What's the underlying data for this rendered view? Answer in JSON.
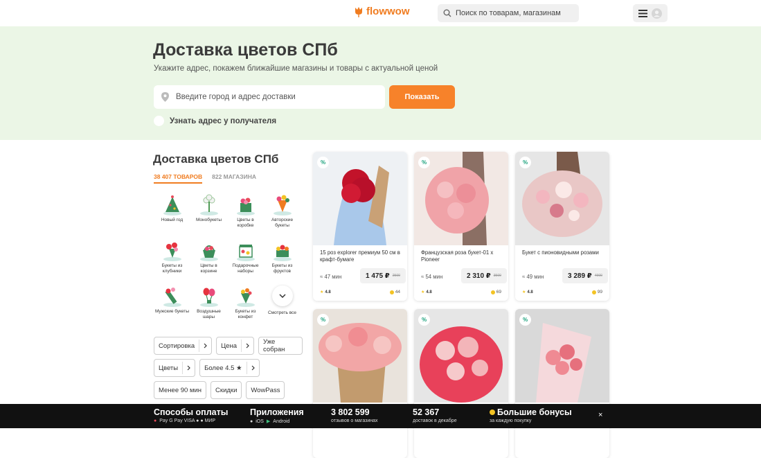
{
  "header": {
    "logo_text": "flowwow",
    "search_placeholder": "Поиск по товарам, магазинам"
  },
  "hero": {
    "title": "Доставка цветов СПб",
    "subtitle": "Укажите адрес, покажем ближайшие магазины и товары с актуальной ценой",
    "address_placeholder": "Введите город и адрес доставки",
    "show_button": "Показать",
    "recipient_label": "Узнать адрес у получателя"
  },
  "sidebar": {
    "title": "Доставка цветов СПб",
    "tabs": [
      "38 407 ТОВАРОВ",
      "822 МАГАЗИНА"
    ],
    "categories": [
      {
        "label": "Новый год",
        "icon": "christmas-tree-icon"
      },
      {
        "label": "Монобукеты",
        "icon": "mono-bouquet-icon"
      },
      {
        "label": "Цветы в коробке",
        "icon": "flower-box-icon"
      },
      {
        "label": "Авторские букеты",
        "icon": "author-bouquet-icon"
      },
      {
        "label": "Букеты из клубники",
        "icon": "strawberry-bouquet-icon"
      },
      {
        "label": "Цветы в корзине",
        "icon": "flower-basket-icon"
      },
      {
        "label": "Подарочные наборы",
        "icon": "gift-set-icon"
      },
      {
        "label": "Букеты из фруктов",
        "icon": "fruit-bouquet-icon"
      },
      {
        "label": "Мужские букеты",
        "icon": "mens-bouquet-icon"
      },
      {
        "label": "Воздушные шары",
        "icon": "balloons-icon"
      },
      {
        "label": "Букеты из конфет",
        "icon": "candy-bouquet-icon"
      }
    ],
    "see_all": "Смотреть все",
    "filters": {
      "sort": "Сортировка",
      "price": "Цена",
      "assembled": "Уже собран",
      "flowers": "Цветы",
      "rating": "Более 4.5 ★",
      "time": "Менее 90 мин",
      "discounts": "Скидки",
      "wowpass": "WowPass"
    }
  },
  "products": [
    {
      "name": "15 роз explorer премиум 50 см в крафт-бумаге",
      "time": "≈ 47 мин",
      "price": "1 475 ₽",
      "old_price": "2500",
      "rating": "4.8",
      "bonus": "44",
      "badge": "%",
      "colors": [
        "#aac8e6",
        "#c2132a"
      ]
    },
    {
      "name": "Французская роза букет-01 х Pioneer",
      "time": "≈ 54 мин",
      "price": "2 310 ₽",
      "old_price": "3500",
      "rating": "4.8",
      "bonus": "69",
      "badge": "%",
      "colors": [
        "#f2e8e4",
        "#f0a3a8"
      ]
    },
    {
      "name": "Букет с пионовидными розами",
      "time": "≈ 49 мин",
      "price": "3 289 ₽",
      "old_price": "4900",
      "rating": "4.8",
      "bonus": "99",
      "badge": "%",
      "colors": [
        "#e6e6e6",
        "#f3b6bf"
      ]
    },
    {
      "name": "",
      "time": "",
      "price": "",
      "old_price": "",
      "rating": "",
      "bonus": "",
      "badge": "%",
      "colors": [
        "#e9e3dc",
        "#f2a6a6"
      ]
    },
    {
      "name": "",
      "time": "",
      "price": "",
      "old_price": "",
      "rating": "",
      "bonus": "",
      "badge": "%",
      "colors": [
        "#e6e6e6",
        "#e8415a"
      ]
    },
    {
      "name": "",
      "time": "",
      "price": "",
      "old_price": "",
      "rating": "",
      "bonus": "",
      "badge": "%",
      "colors": [
        "#d9d9d9",
        "#ef8a93"
      ]
    }
  ],
  "footer": {
    "payment_title": "Способы оплаты",
    "payment_methods": "Pay  G Pay  VISA  ● ●  МИР",
    "apps_title": "Приложения",
    "ios": "iOS",
    "android": "Android",
    "reviews_count": "3 802 599",
    "reviews_label": "отзывов о магазинах",
    "deliveries_count": "52 367",
    "deliveries_label": "доставок в декабре",
    "bonus_title": "Большие бонусы",
    "bonus_label": "за каждую покупку",
    "close": "×"
  },
  "colors": {
    "accent": "#f7822a",
    "hero_bg": "#ebf6e6",
    "footer_bg": "#111111"
  }
}
